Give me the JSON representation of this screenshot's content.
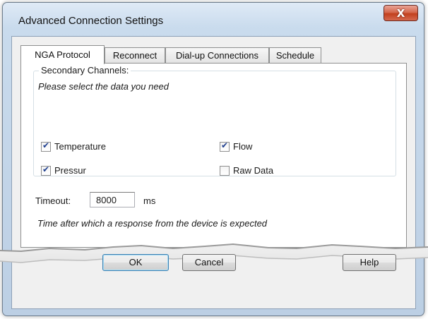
{
  "window": {
    "title": "Advanced Connection Settings",
    "close_label": "X"
  },
  "tabs": [
    {
      "label": "NGA Protocol",
      "active": true
    },
    {
      "label": "Reconnect",
      "active": false
    },
    {
      "label": "Dial-up Connections",
      "active": false
    },
    {
      "label": "Schedule",
      "active": false
    }
  ],
  "secondary_channels": {
    "title": "Secondary Channels:",
    "hint": "Please select the data you need",
    "options": [
      {
        "label": "Temperature",
        "checked": true
      },
      {
        "label": "Flow",
        "checked": true
      },
      {
        "label": "Pressur",
        "checked": true
      },
      {
        "label": "Raw Data",
        "checked": false
      }
    ]
  },
  "timeout": {
    "label": "Timeout:",
    "value": "8000",
    "unit": "ms",
    "hint": "Time after which a response from the device is expected"
  },
  "buttons": {
    "ok": "OK",
    "cancel": "Cancel",
    "help": "Help"
  }
}
